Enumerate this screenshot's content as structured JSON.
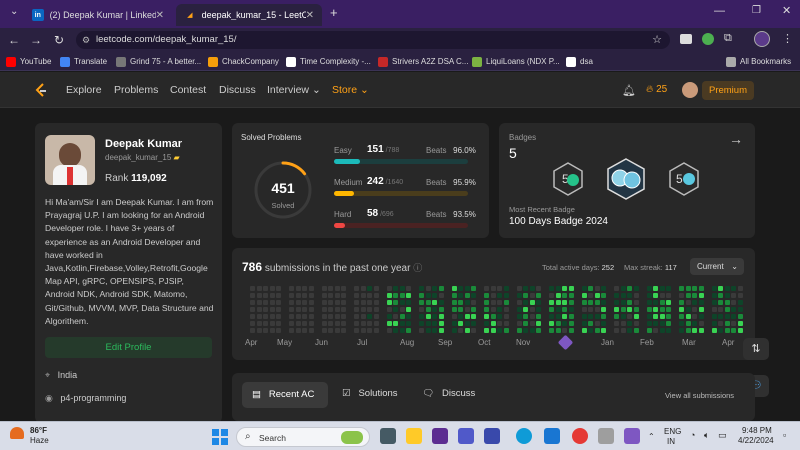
{
  "browser": {
    "tabs": [
      {
        "title": "(2) Deepak Kumar | LinkedIn",
        "favicon_text": "in"
      },
      {
        "title": "deepak_kumar_15 - LeetCode",
        "favicon_text": ""
      }
    ],
    "new_tab": "+",
    "url": "leetcode.com/deepak_kumar_15/",
    "bookmarks": [
      "YouTube",
      "Translate",
      "Grind 75 - A better...",
      "ChackCompany",
      "Time Complexity -...",
      "Strivers A2Z DSA C...",
      "LiquiLoans (NDX P...",
      "dsa"
    ],
    "all_bookmarks": "All Bookmarks"
  },
  "lc_nav": {
    "items": [
      "Explore",
      "Problems",
      "Contest",
      "Discuss",
      "Interview",
      "Store"
    ],
    "streak": "25",
    "premium": "Premium"
  },
  "profile": {
    "name": "Deepak Kumar",
    "username": "deepak_kumar_15",
    "rank_label": "Rank",
    "rank_value": "119,092",
    "bio": "Hi Ma'am/Sir I am Deepak Kumar. I am from Prayagraj U.P. I am looking for an Android Developer role. I have 3+ years of experience as an Android Developer and have worked in Java,Kotlin,Firebase,Volley,Retrofit,Google Map API, gRPC, OPENSIPS, PJSIP, Android NDK, Android SDK, Matomo, Git/Github, MVVM, MVP, Data Structure and Algorithem.",
    "edit_button": "Edit Profile",
    "location": "India",
    "github": "p4-programming",
    "extra": "...."
  },
  "solved": {
    "title": "Solved Problems",
    "total": "451",
    "total_label": "Solved",
    "progress_fraction": 0.147,
    "rows": [
      {
        "label": "Easy",
        "count": "151",
        "total": "/788",
        "beats_label": "Beats",
        "beats": "96.0%",
        "fraction": 0.192,
        "color": "#1cbaba"
      },
      {
        "label": "Medium",
        "count": "242",
        "total": "/1640",
        "beats_label": "Beats",
        "beats": "95.9%",
        "fraction": 0.148,
        "color": "#ffb700"
      },
      {
        "label": "Hard",
        "count": "58",
        "total": "/696",
        "beats_label": "Beats",
        "beats": "93.5%",
        "fraction": 0.083,
        "color": "#ef4743"
      }
    ]
  },
  "badges": {
    "title": "Badges",
    "count": "5",
    "recent_label": "Most Recent Badge",
    "recent_name": "100 Days Badge 2024"
  },
  "submissions": {
    "count": "786",
    "label": "submissions in the past one year",
    "active_days_label": "Total active days:",
    "active_days": "252",
    "max_streak_label": "Max streak:",
    "max_streak": "117",
    "dropdown": "Current",
    "months": [
      "Apr",
      "May",
      "Jun",
      "Jul",
      "Aug",
      "Sep",
      "Oct",
      "Nov",
      "Jan",
      "Feb",
      "Mar",
      "Apr"
    ]
  },
  "tabs_bottom": {
    "recent": "Recent AC",
    "solutions": "Solutions",
    "discuss": "Discuss",
    "view_all": "View all submissions"
  },
  "taskbar": {
    "temp": "86°F",
    "weather": "Haze",
    "search": "Search",
    "lang1": "ENG",
    "lang2": "IN",
    "time": "9:48 PM",
    "date": "4/22/2024"
  },
  "colors": {
    "accent_orange": "#ffa116",
    "green_button": "#2cbb5d"
  }
}
